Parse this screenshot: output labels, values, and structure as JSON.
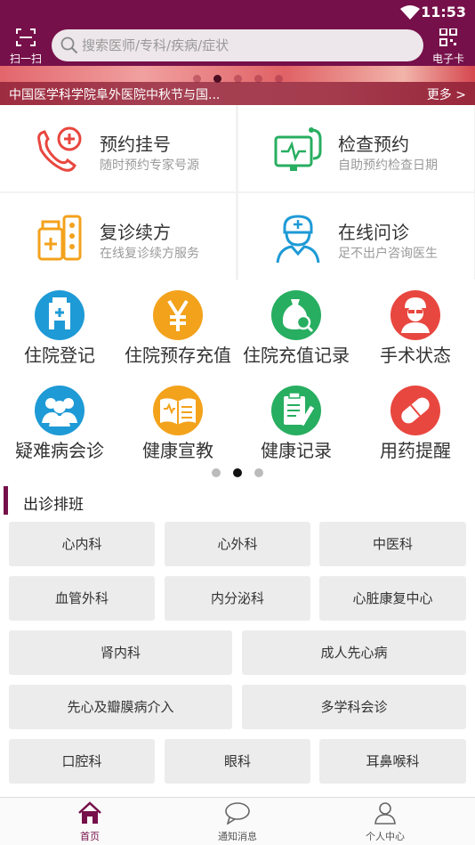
{
  "status_bar": {
    "time": "11:53"
  },
  "header": {
    "scan_label": "扫一扫",
    "search_placeholder": "搜索医师/专科/疾病/症状",
    "ecard_label": "电子卡"
  },
  "banner": {
    "news_text": "中国医学科学院阜外医院中秋节与国...",
    "more_label": "更多 >",
    "dot_count": 5,
    "active_dot": 1
  },
  "main_services": [
    {
      "title": "预约挂号",
      "subtitle": "随时预约专家号源",
      "icon": "phone-plus-icon"
    },
    {
      "title": "检查预约",
      "subtitle": "自助预约检查日期",
      "icon": "stethoscope-monitor-icon"
    },
    {
      "title": "复诊续方",
      "subtitle": "在线复诊续方服务",
      "icon": "medicine-bottle-icon"
    },
    {
      "title": "在线问诊",
      "subtitle": "足不出户咨询医生",
      "icon": "doctor-icon"
    }
  ],
  "quick_icons_row1": [
    {
      "label": "住院登记",
      "icon": "hospital-building-icon",
      "color": "#1e9ad6"
    },
    {
      "label": "住院预存充值",
      "icon": "yen-icon",
      "color": "#f3a21c"
    },
    {
      "label": "住院充值记录",
      "icon": "money-bag-search-icon",
      "color": "#27ae60"
    },
    {
      "label": "手术状态",
      "icon": "surgeon-icon",
      "color": "#e8473f"
    }
  ],
  "quick_icons_row2": [
    {
      "label": "疑难病会诊",
      "icon": "group-consult-icon",
      "color": "#1e9ad6"
    },
    {
      "label": "健康宣教",
      "icon": "open-book-icon",
      "color": "#f3a21c"
    },
    {
      "label": "健康记录",
      "icon": "clipboard-pen-icon",
      "color": "#27ae60"
    },
    {
      "label": "用药提醒",
      "icon": "pill-icon",
      "color": "#e8473f"
    }
  ],
  "pager": {
    "dot_count": 3,
    "active_dot": 1
  },
  "schedule": {
    "title": "出诊排班",
    "departments": [
      "心内科",
      "心外科",
      "中医科",
      "血管外科",
      "内分泌科",
      "心脏康复中心",
      "肾内科",
      "成人先心病",
      "先心及瓣膜病介入",
      "多学科会诊",
      "口腔科",
      "眼科",
      "耳鼻喉科"
    ]
  },
  "tabbar": {
    "items": [
      {
        "label": "首页",
        "icon": "home-icon",
        "active": true
      },
      {
        "label": "通知消息",
        "icon": "chat-bubble-icon",
        "active": false
      },
      {
        "label": "个人中心",
        "icon": "user-icon",
        "active": false
      }
    ]
  },
  "colors": {
    "brand": "#76104a",
    "active_tab": "#76104a"
  }
}
